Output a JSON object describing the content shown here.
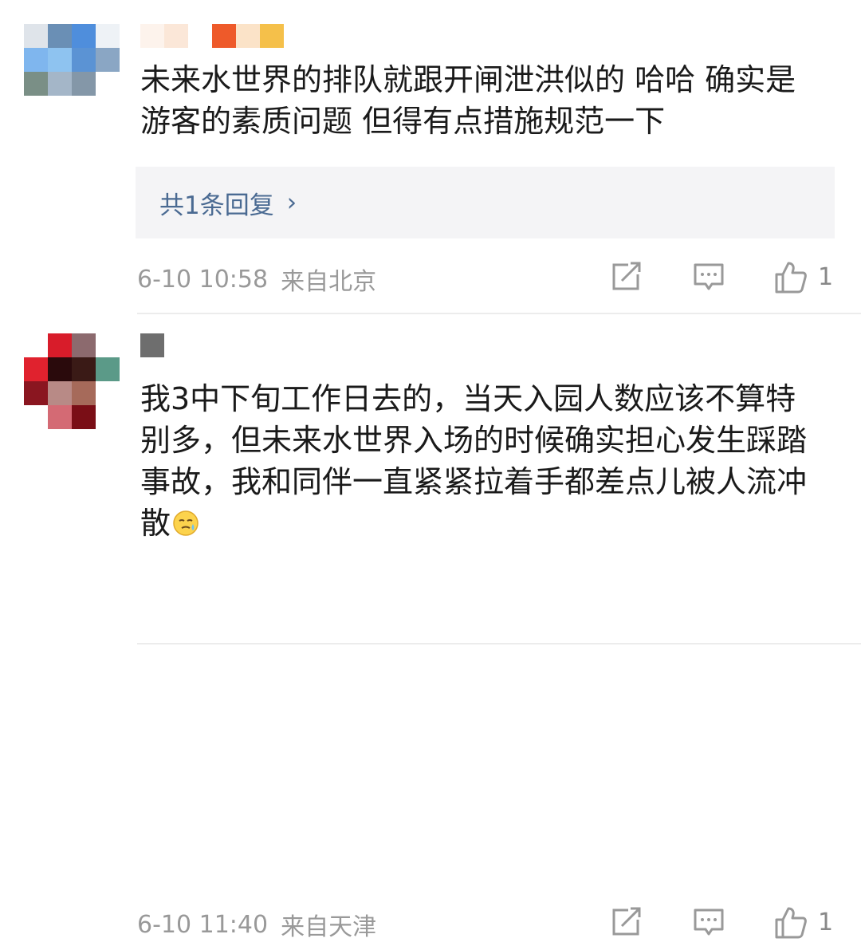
{
  "comments": [
    {
      "avatar_pixels": [
        "#dfe4ea",
        "#6a8fb5",
        "#4f8edc",
        "#eef2f6",
        "#7fb6ee",
        "#8ec3f0",
        "#5b93d4",
        "#8aa6c4",
        "#7a8f86",
        "#a4b6c8",
        "#8497a8",
        "#ffffff",
        "#ffffff",
        "#ffffff",
        "#ffffff",
        "#ffffff"
      ],
      "username_blocks": [
        "#fdf3ec",
        "#fbe7d8",
        "#ffffff",
        "#ee5a2a",
        "#fbe3c8",
        "#f5c04a"
      ],
      "text": "未来水世界的排队就跟开闸泄洪似的 哈哈 确实是游客的素质问题 但得有点措施规范一下",
      "reply_label": "共1条回复",
      "reply_chevron": "›",
      "time": "6-10 10:58",
      "location": "来自北京",
      "likes": "1"
    },
    {
      "avatar_pixels": [
        "#ffffff",
        "#d81c2a",
        "#8c6a6e",
        "#ffffff",
        "#e0222e",
        "#2a0a0c",
        "#3a1a16",
        "#5b9a88",
        "#8a1620",
        "#b88a86",
        "#a66a5a",
        "#ffffff",
        "#ffffff",
        "#d46a74",
        "#7a0e16",
        "#ffffff"
      ],
      "username_blocks": [
        "#6e6e6e"
      ],
      "text": "我3中下旬工作日去的，当天入园人数应该不算特别多，但未来水世界入场的时候确实担心发生踩踏事故，我和同伴一直紧紧拉着手都差点儿被人流冲散",
      "emoji": "sweat-smile-emoji",
      "time": "6-10 11:40",
      "location": "来自天津",
      "likes": "1"
    }
  ],
  "icons": {
    "repost": "repost-icon",
    "comment": "comment-icon",
    "like": "like-icon",
    "icon_color": "#999999"
  }
}
